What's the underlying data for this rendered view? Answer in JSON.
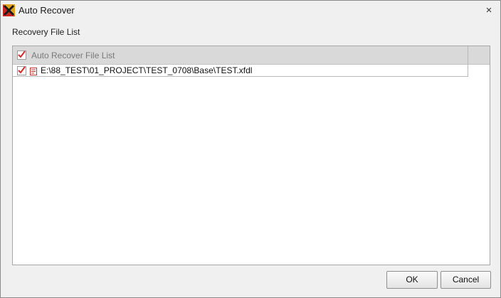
{
  "window": {
    "title": "Auto Recover",
    "app_icon": "app-logo-icon",
    "close_glyph": "×"
  },
  "section": {
    "label": "Recovery File List"
  },
  "list": {
    "header": {
      "label": "Auto Recover File List",
      "checked": true
    },
    "items": [
      {
        "path": "E:\\88_TEST\\01_PROJECT\\TEST_0708\\Base\\TEST.xfdl",
        "checked": true,
        "icon": "file-icon"
      }
    ]
  },
  "buttons": {
    "ok_label": "OK",
    "cancel_label": "Cancel"
  },
  "colors": {
    "check_mark": "#d42a2a",
    "header_bg": "#d9d9d9",
    "window_bg": "#f0f0f0"
  }
}
